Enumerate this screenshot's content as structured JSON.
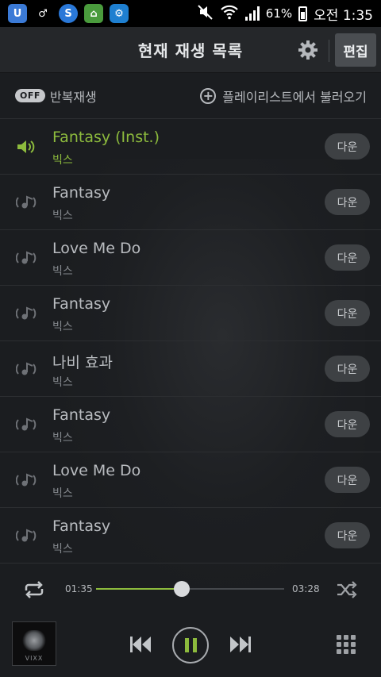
{
  "status_bar": {
    "app_icons": [
      "U",
      "♂",
      "S",
      "⌂",
      "⚙"
    ],
    "battery": "61%",
    "time": "오전 1:35"
  },
  "header": {
    "title": "현재 재생 목록",
    "edit_label": "편집",
    "settings_icon": "gear-icon"
  },
  "options": {
    "repeat_toggle": "OFF",
    "repeat_label": "반복재생",
    "load_playlist_label": "플레이리스트에서 불러오기"
  },
  "playlist": [
    {
      "title": "Fantasy (Inst.)",
      "artist": "빅스",
      "action": "다운",
      "active": true
    },
    {
      "title": "Fantasy",
      "artist": "빅스",
      "action": "다운",
      "active": false
    },
    {
      "title": "Love Me Do",
      "artist": "빅스",
      "action": "다운",
      "active": false
    },
    {
      "title": "Fantasy",
      "artist": "빅스",
      "action": "다운",
      "active": false
    },
    {
      "title": "나비 효과",
      "artist": "빅스",
      "action": "다운",
      "active": false
    },
    {
      "title": "Fantasy",
      "artist": "빅스",
      "action": "다운",
      "active": false
    },
    {
      "title": "Love Me Do",
      "artist": "빅스",
      "action": "다운",
      "active": false
    },
    {
      "title": "Fantasy",
      "artist": "빅스",
      "action": "다운",
      "active": false
    }
  ],
  "player": {
    "current_time": "01:35",
    "total_time": "03:28",
    "progress_fraction": 0.457,
    "album_text": "VIXX",
    "accent_color": "#8dbb3d"
  }
}
